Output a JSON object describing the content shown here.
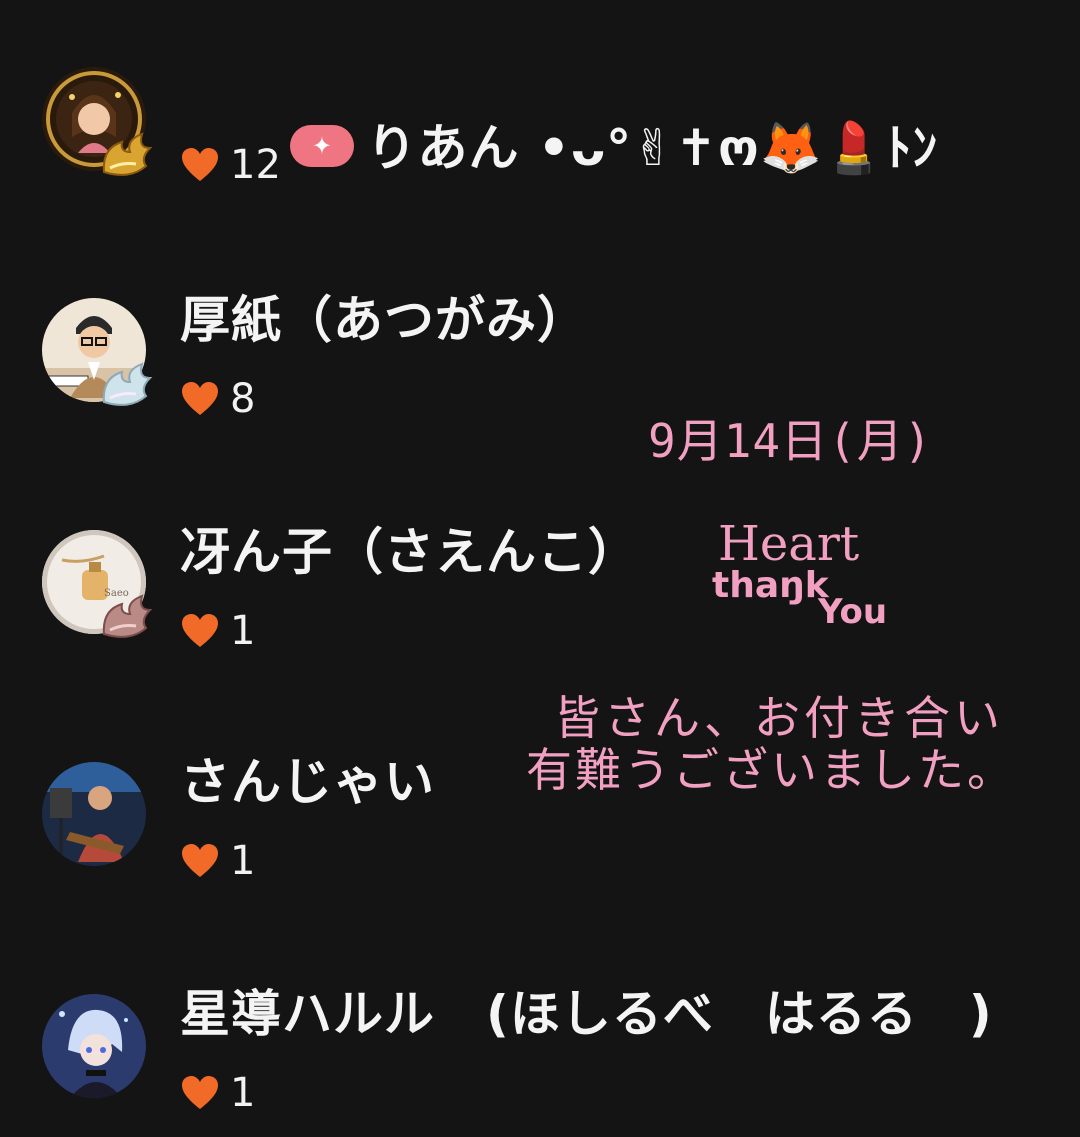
{
  "users": [
    {
      "name": "りあん •ᴗ°✌︎✝︎ო🦊💄ﾄﾝ",
      "likes": "12",
      "has_vip_badge": true,
      "avatar": "girl-portrait-gold-frame",
      "badge": "gold-wing-badge"
    },
    {
      "name": "厚紙（あつがみ）",
      "likes": "8",
      "has_vip_badge": false,
      "avatar": "man-glasses-piano",
      "badge": "pearl-wing-badge"
    },
    {
      "name": "冴ん子（さえんこ）",
      "likes": "1",
      "has_vip_badge": false,
      "avatar": "perfume-bottle",
      "badge": "rose-wing-badge"
    },
    {
      "name": "さんじゃい",
      "likes": "1",
      "has_vip_badge": false,
      "avatar": "guitarist-stage",
      "badge": ""
    },
    {
      "name": "星導ハルル　(ほしるべ　はるる　)",
      "likes": "1",
      "has_vip_badge": false,
      "avatar": "anime-boy-blue",
      "badge": ""
    }
  ],
  "overlay": {
    "date": "9月14日(月)",
    "heart": "Heart",
    "thank": "thaŋk",
    "you": "You",
    "message_line1": "皆さん、お付き合い",
    "message_line2": "有難うございました。"
  },
  "colors": {
    "background": "#141414",
    "heart": "#f26a28",
    "overlay_text": "#f2a0c2",
    "vip_chip": "#f07582"
  },
  "icons": {
    "like": "heart-icon",
    "vip": "sparkle-chip-icon"
  }
}
